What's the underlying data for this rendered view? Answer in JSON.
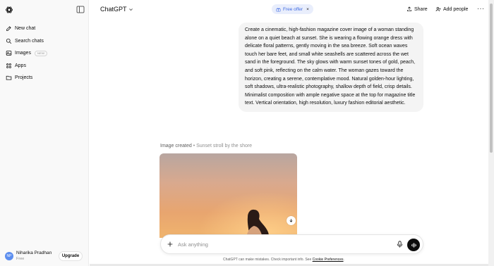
{
  "sidebar": {
    "items": [
      {
        "label": "New chat",
        "icon": "edit-icon"
      },
      {
        "label": "Search chats",
        "icon": "search-icon"
      },
      {
        "label": "Images",
        "icon": "image-icon",
        "badge": "NEW"
      },
      {
        "label": "Apps",
        "icon": "apps-grid-icon"
      },
      {
        "label": "Projects",
        "icon": "folder-icon"
      }
    ],
    "user": {
      "initials": "NP",
      "name": "Niharika Pradhan",
      "plan": "Free",
      "avatar_color": "#5b8def"
    },
    "upgrade_label": "Upgrade"
  },
  "header": {
    "model": "ChatGPT",
    "offer": "Free offer",
    "offer_close": "×",
    "share": "Share",
    "add_people": "Add people",
    "more": "···"
  },
  "conversation": {
    "user_message": "Create a cinematic, high-fashion magazine cover image of a woman standing alone on a quiet beach at sunset. She is wearing a flowing orange dress with delicate floral patterns, gently moving in the sea breeze. Soft ocean waves touch her bare feet, and small white seashells are scattered across the wet sand in the foreground. The sky glows with warm sunset tones of gold, peach, and soft pink, reflecting on the calm water. The woman gazes toward the horizon, creating a serene, contemplative mood. Natural golden-hour lighting, soft shadows, ultra-realistic photography, shallow depth of field, crisp details. Minimalist composition with ample negative space at the top for magazine title text. Vertical orientation, high resolution, luxury fashion editorial aesthetic.",
    "image_caption": "Image created",
    "image_separator": " • ",
    "image_title": "Sunset stroll by the shore"
  },
  "composer": {
    "placeholder": "Ask anything"
  },
  "footer": {
    "disclaimer": "ChatGPT can make mistakes. Check important info. See ",
    "link": "Cookie Preferences",
    "end": "."
  },
  "colors": {
    "accent": "#3e6ae1",
    "offer_bg": "#e9eefc",
    "bubble_bg": "#f4f4f4",
    "sidebar_bg": "#f9f9f9"
  }
}
